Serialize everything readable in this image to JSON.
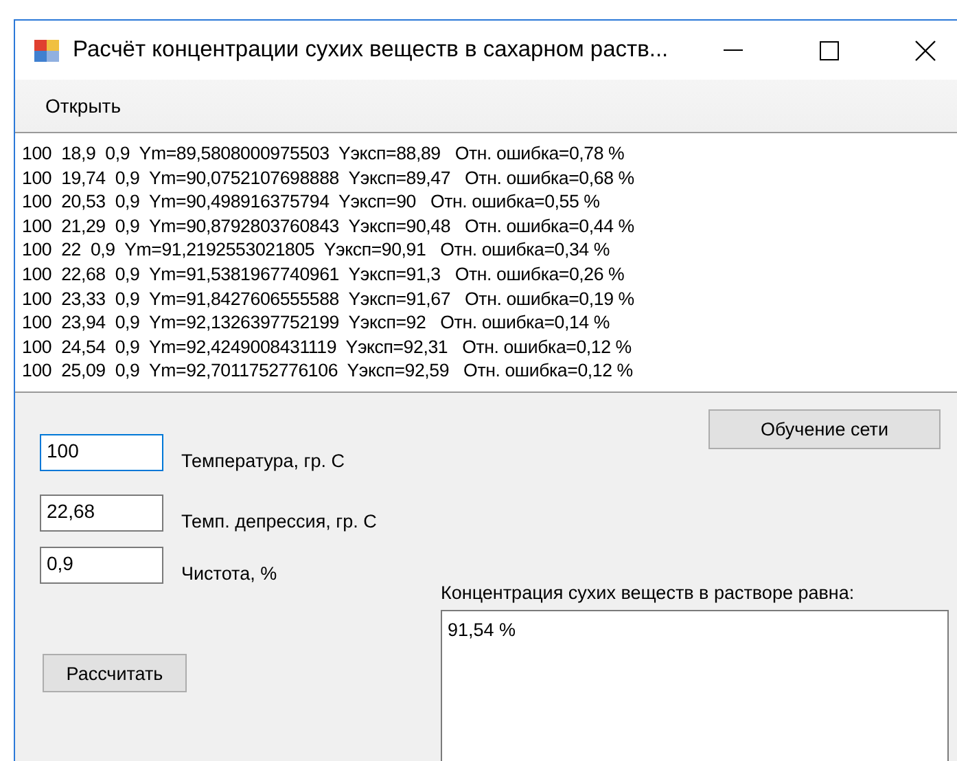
{
  "window": {
    "title": "Расчёт концентрации сухих веществ в сахарном раств..."
  },
  "menu": [
    {
      "label": "Открыть"
    }
  ],
  "log": [
    "100  18,9  0,9  Ym=89,5808000975503  Yэксп=88,89   Отн. ошибка=0,78 %",
    "100  19,74  0,9  Ym=90,0752107698888  Yэксп=89,47   Отн. ошибка=0,68 %",
    "100  20,53  0,9  Ym=90,498916375794  Yэксп=90   Отн. ошибка=0,55 %",
    "100  21,29  0,9  Ym=90,8792803760843  Yэксп=90,48   Отн. ошибка=0,44 %",
    "100  22  0,9  Ym=91,2192553021805  Yэксп=90,91   Отн. ошибка=0,34 %",
    "100  22,68  0,9  Ym=91,5381967740961  Yэксп=91,3   Отн. ошибка=0,26 %",
    "100  23,33  0,9  Ym=91,8427606555588  Yэксп=91,67   Отн. ошибка=0,19 %",
    "100  23,94  0,9  Ym=92,1326397752199  Yэксп=92   Отн. ошибка=0,14 %",
    "100  24,54  0,9  Ym=92,4249008431119  Yэксп=92,31   Отн. ошибка=0,12 %",
    "100  25,09  0,9  Ym=92,7011752776106  Yэксп=92,59   Отн. ошибка=0,12 %"
  ],
  "inputs": [
    {
      "value": "100",
      "label": "Температура, гр. С",
      "focused": true
    },
    {
      "value": "22,68",
      "label": "Темп. депрессия, гр. С",
      "focused": false
    },
    {
      "value": "0,9",
      "label": "Чистота, %",
      "focused": false
    }
  ],
  "calculate_button": "Рассчитать",
  "train_button": "Обучение сети",
  "result": {
    "label": "Концентрация сухих веществ в растворе равна:",
    "value": "91,54 %"
  }
}
